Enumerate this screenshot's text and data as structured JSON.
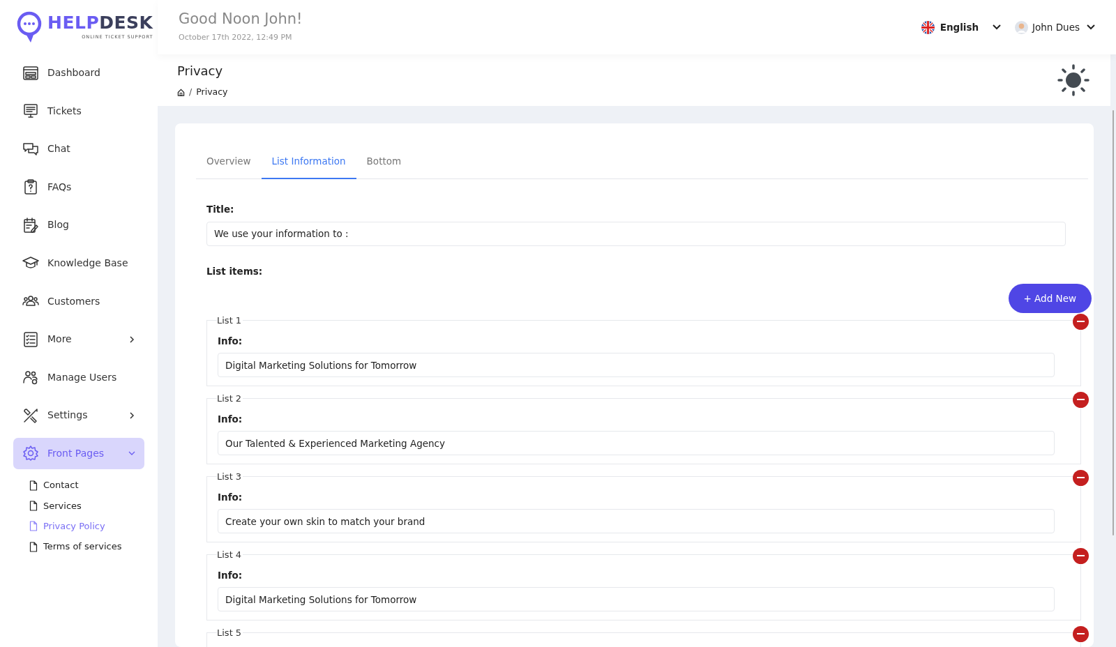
{
  "logo": {
    "name_part_1": "HELP",
    "name_part_2": "DESK",
    "tagline": "ONLINE TICKET SUPPORT"
  },
  "header": {
    "greeting": "Good Noon John!",
    "date": "October 17th 2022, 12:49 PM",
    "language": "English",
    "user": "John Dues"
  },
  "sidebar": {
    "items": [
      {
        "label": "Dashboard",
        "selected": false
      },
      {
        "label": "Tickets",
        "selected": false
      },
      {
        "label": "Chat",
        "selected": false
      },
      {
        "label": "FAQs",
        "selected": false
      },
      {
        "label": "Blog",
        "selected": false
      },
      {
        "label": "Knowledge Base",
        "selected": false
      },
      {
        "label": "Customers",
        "selected": false
      },
      {
        "label": "More",
        "selected": false,
        "expanded": false
      },
      {
        "label": "Manage Users",
        "selected": false
      },
      {
        "label": "Settings",
        "selected": false,
        "expanded": false
      },
      {
        "label": "Front Pages",
        "selected": true,
        "expanded": true,
        "children": [
          {
            "label": "Contact",
            "selected": false
          },
          {
            "label": "Services",
            "selected": false
          },
          {
            "label": "Privacy Policy",
            "selected": true
          },
          {
            "label": "Terms of services",
            "selected": false
          }
        ]
      }
    ]
  },
  "page": {
    "title": "Privacy",
    "breadcrumb": [
      {
        "separator": "/",
        "label": "Privacy"
      }
    ]
  },
  "tabs": [
    {
      "label": "Overview",
      "selected": false
    },
    {
      "label": "List Information",
      "selected": true
    },
    {
      "label": "Bottom",
      "selected": false
    }
  ],
  "form": {
    "title_label": "Title:",
    "title_value": "We use your information to :",
    "list_items_label": "List items:",
    "add_button": "+ Add New",
    "lists": [
      {
        "legend": "List 1",
        "info_label": "Info:",
        "info": "Digital Marketing Solutions for Tomorrow"
      },
      {
        "legend": "List 2",
        "info_label": "Info:",
        "info": "Our Talented & Experienced Marketing Agency"
      },
      {
        "legend": "List 3",
        "info_label": "Info:",
        "info": "Create your own skin to match your brand"
      },
      {
        "legend": "List 4",
        "info_label": "Info:",
        "info": "Digital Marketing Solutions for Tomorrow"
      },
      {
        "legend": "List 5"
      }
    ]
  }
}
